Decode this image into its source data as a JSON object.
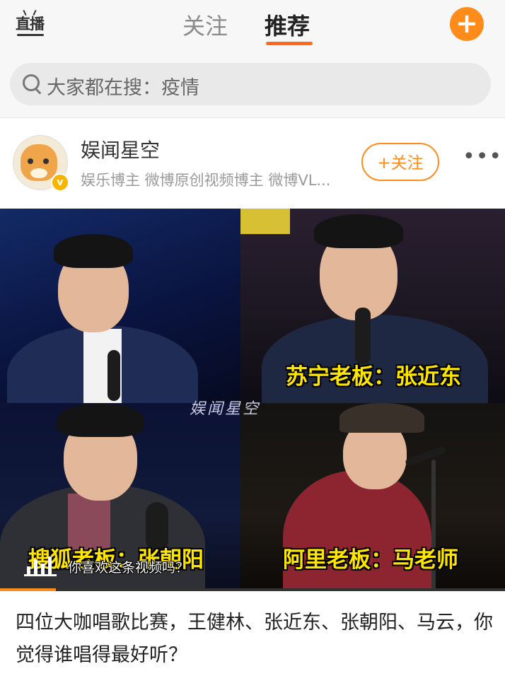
{
  "header": {
    "live_label": "直播",
    "tabs": [
      {
        "label": "关注",
        "active": false
      },
      {
        "label": "推荐",
        "active": true
      }
    ],
    "add_label": "+"
  },
  "search": {
    "placeholder": "大家都在搜：疫情"
  },
  "post": {
    "author": {
      "name": "娱闻星空",
      "description": "娱乐博主 微博原创视频博主 微博VL...",
      "follow_label": "+关注",
      "more_label": "•••"
    },
    "video": {
      "captions": [
        "苏宁老板：张近东",
        "搜狐老板：张朝阳",
        "阿里老板：马老师"
      ],
      "watermark": "娱闻星空",
      "question": "你喜欢这条视频吗？",
      "progress": 0.11
    },
    "text": "四位大咖唱歌比赛，王健林、张近东、张朝阳、马云，你觉得谁唱得最好听？"
  },
  "colors": {
    "accent": "#ff8c1a",
    "caption": "#ffe600"
  }
}
